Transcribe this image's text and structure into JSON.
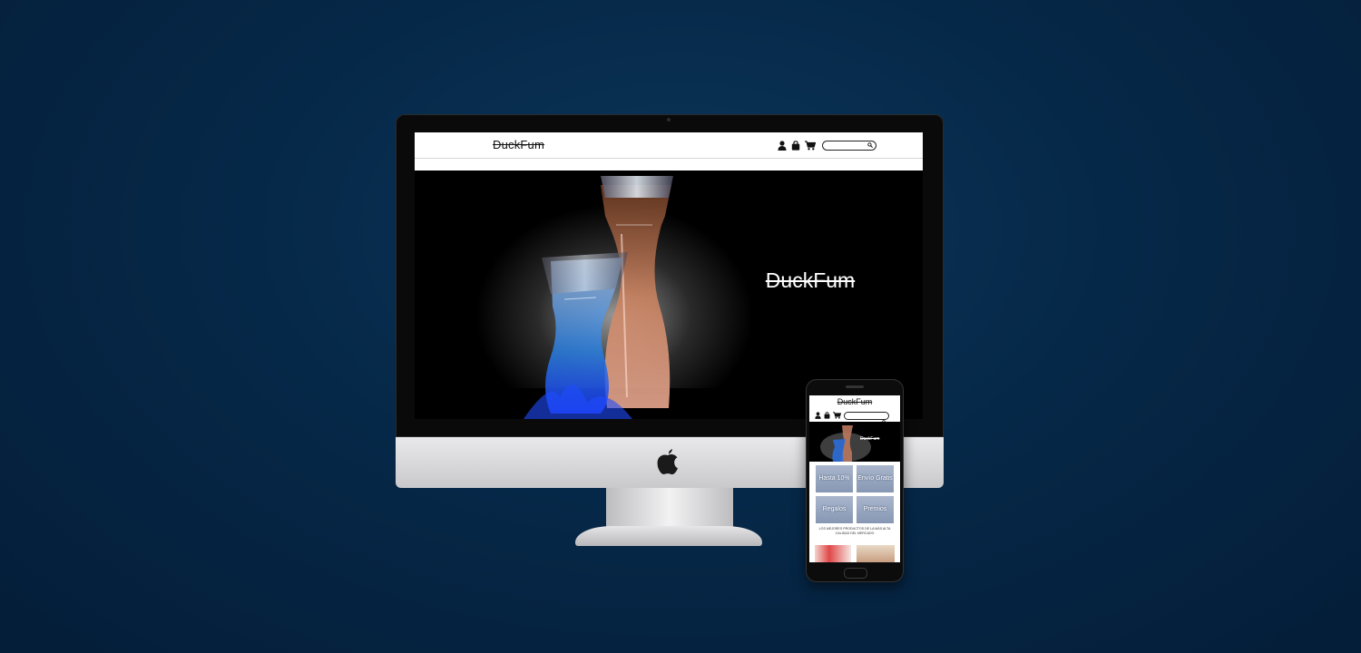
{
  "desktop": {
    "header": {
      "brand": "DuckFum",
      "icons": [
        "user-icon",
        "shopping-bag-icon",
        "cart-icon",
        "search-icon"
      ],
      "search_placeholder": ""
    },
    "hero": {
      "brand": "DuckFum"
    }
  },
  "mobile": {
    "header": {
      "brand": "DuckFum",
      "icons": [
        "user-icon",
        "shopping-bag-icon",
        "cart-icon",
        "search-icon"
      ]
    },
    "hero": {
      "brand": "DuckFum"
    },
    "tiles": [
      {
        "label": "Hasta 10%"
      },
      {
        "label": "Envío Gratis"
      },
      {
        "label": "Regalos"
      },
      {
        "label": "Premios"
      }
    ],
    "caption": "LOS MEJORES PRODUCTOS DE LA MÁS ALTA CALIDAD DEL MERCADO"
  },
  "colors": {
    "background": "#062848",
    "screen_black": "#000000",
    "header_white": "#ffffff",
    "tile_blue": "#8797b3"
  }
}
